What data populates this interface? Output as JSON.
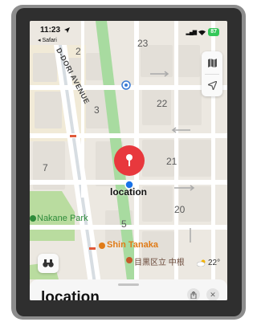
{
  "status_bar": {
    "time": "11:23",
    "back_app": "◂ Safari",
    "battery": "87"
  },
  "map": {
    "block_numbers": [
      "2",
      "23",
      "3",
      "22",
      "7",
      "21",
      "20",
      "5"
    ],
    "street_name": "D-DORI AVENUE",
    "park_name": "Nakane Park",
    "poi_name": "Shin Tanaka",
    "poi2_name": "目黒区立 中根",
    "pin_label": "location",
    "weather": "22°"
  },
  "sheet": {
    "title": "location"
  },
  "icons": {
    "map_mode": "map-icon",
    "locate": "location-arrow-icon",
    "look_around": "binoculars-icon",
    "share": "share-icon",
    "close": "close-icon",
    "transit": "transit-icon",
    "weather": "cloud-sun-icon"
  },
  "colors": {
    "pin": "#e8383d",
    "user_dot": "#1a73e8",
    "park_green": "#b9dc9f",
    "rail_green": "#a8dba0",
    "poi_orange": "#e07b17",
    "battery": "#34c759"
  }
}
